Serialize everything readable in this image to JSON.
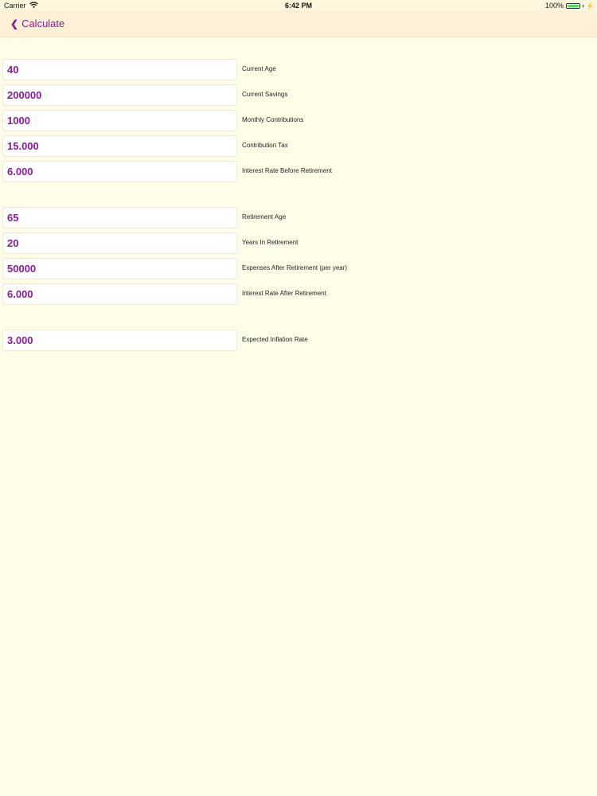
{
  "status_bar": {
    "carrier": "Carrier",
    "time": "6:42 PM",
    "battery_percent": "100%",
    "battery_level": 1.0
  },
  "nav": {
    "back_label": "Calculate"
  },
  "colors": {
    "accent": "#8b1a9c",
    "background": "#fefee8",
    "nav_background": "#fdf0d6"
  },
  "fields": [
    {
      "value": "40",
      "label": "Current Age"
    },
    {
      "value": "200000",
      "label": "Current Savings"
    },
    {
      "value": "1000",
      "label": "Monthly Contributions"
    },
    {
      "value": "15.000",
      "label": "Contribution Tax"
    },
    {
      "value": "6.000",
      "label": "Interest Rate Before Retirement"
    },
    {
      "value": "65",
      "label": "Retirement Age"
    },
    {
      "value": "20",
      "label": "Years In Retirement"
    },
    {
      "value": "50000",
      "label": "Expenses After Retirement (per year)"
    },
    {
      "value": "6.000",
      "label": "Interest Rate After Retirement"
    },
    {
      "value": "3.000",
      "label": "Expected Inflation Rate"
    }
  ]
}
